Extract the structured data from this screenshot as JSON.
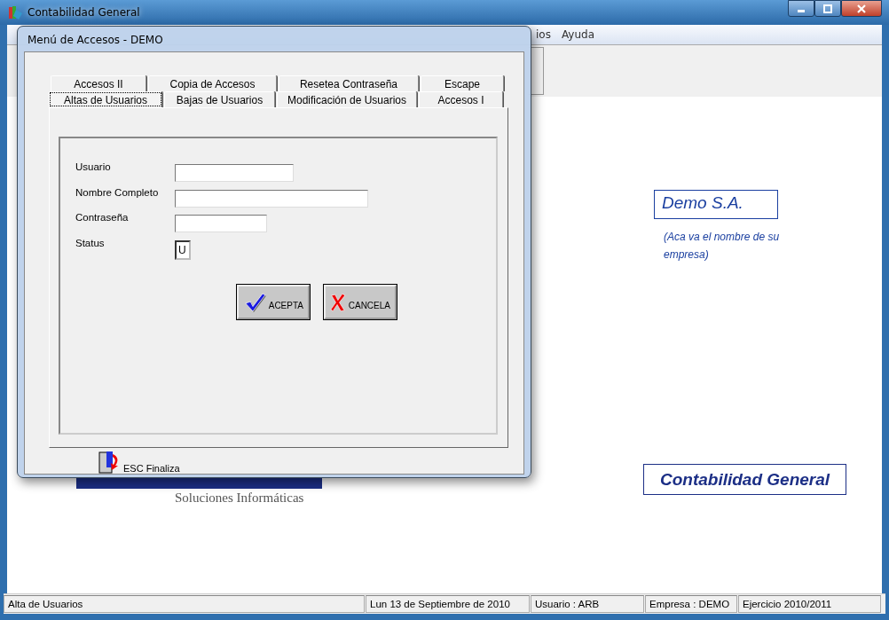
{
  "window": {
    "title": "Contabilidad General"
  },
  "menu": [
    "ios",
    "Ayuda"
  ],
  "dialog": {
    "title": "Menú de Accesos  - DEMO",
    "tab_rows": [
      [
        {
          "label": "Accesos II",
          "selected": false
        },
        {
          "label": "Copia de Accesos",
          "selected": false
        },
        {
          "label": "Resetea Contraseña",
          "selected": false
        },
        {
          "label": "Escape",
          "selected": false
        }
      ],
      [
        {
          "label": "Altas de Usuarios",
          "selected": true
        },
        {
          "label": "Bajas de Usuarios",
          "selected": false
        },
        {
          "label": "Modificación de Usuarios",
          "selected": false
        },
        {
          "label": "Accesos I",
          "selected": false
        }
      ]
    ],
    "fields": [
      {
        "label": "Usuario"
      },
      {
        "label": "Nombre Completo"
      },
      {
        "label": "Contraseña"
      },
      {
        "label": "Status",
        "value": "U"
      }
    ],
    "buttons": [
      {
        "label": "ACEPTA",
        "kind": "ok"
      },
      {
        "label": "CANCELA",
        "kind": "cancel"
      }
    ],
    "footer": "ESC Finaliza"
  },
  "logo": {
    "tagline": "Soluciones Informáticas"
  },
  "company": {
    "name": "Demo S.A.",
    "note": "(Aca va el nombre de su empresa)"
  },
  "app_label": "Contabilidad General",
  "status_bar": [
    "Alta de Usuarios",
    "Lun 13 de Septiembre de 2010",
    "Usuario : ARB",
    "Empresa : DEMO",
    "Ejercicio 2010/2011"
  ]
}
